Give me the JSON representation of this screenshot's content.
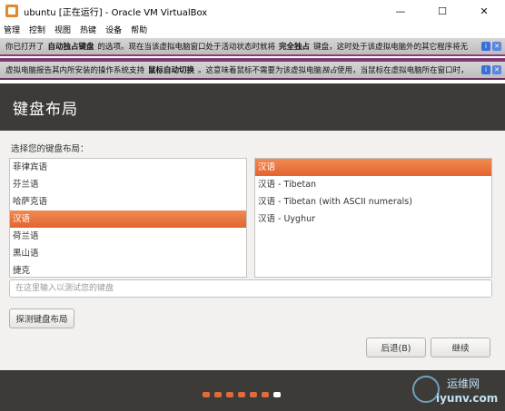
{
  "window": {
    "title": "ubuntu [正在运行] - Oracle VM VirtualBox",
    "minimize": "—",
    "maximize": "☐",
    "close": "✕"
  },
  "menubar": [
    "管理",
    "控制",
    "视图",
    "热键",
    "设备",
    "帮助"
  ],
  "notifications": {
    "first": {
      "pre": "你已打开了",
      "bold1": "自动独占键盘",
      "mid": "的选项。现在当该虚拟电脑窗口处于活动状态时就将",
      "bold2": "完全独占",
      "post": "键盘，这时处于该虚拟电脑外的其它程序将无"
    },
    "second": {
      "pre": "虚拟电脑报告其内所安装的操作系统支持",
      "bold1": "鼠标自动切换",
      "mid": "。这意味着鼠标不需要为该虚拟电脑",
      "italic": "独占",
      "post": "使用，当鼠标在虚拟电脑所在窗口时，"
    }
  },
  "installer": {
    "heading": "键盘布局",
    "prompt": "选择您的键盘布局：",
    "layouts": [
      "菲律宾语",
      "芬兰语",
      "哈萨克语",
      "汉语",
      "荷兰语",
      "黑山语",
      "捷克"
    ],
    "selected_layout_index": 3,
    "variants": [
      "汉语",
      "汉语 - Tibetan",
      "汉语 - Tibetan (with ASCII numerals)",
      "汉语 - Uyghur"
    ],
    "selected_variant_index": 0,
    "test_placeholder": "在这里输入以测试您的键盘",
    "detect_button": "探测键盘布局",
    "back_button": "后退(B)",
    "next_button": "继续"
  },
  "progress": {
    "total_steps": 7,
    "current_step": 7
  },
  "watermark": {
    "top": "运维网",
    "bottom": "iyunv.com"
  },
  "colors": {
    "accent": "#e3642f",
    "dark_bar": "#3c3b37"
  }
}
